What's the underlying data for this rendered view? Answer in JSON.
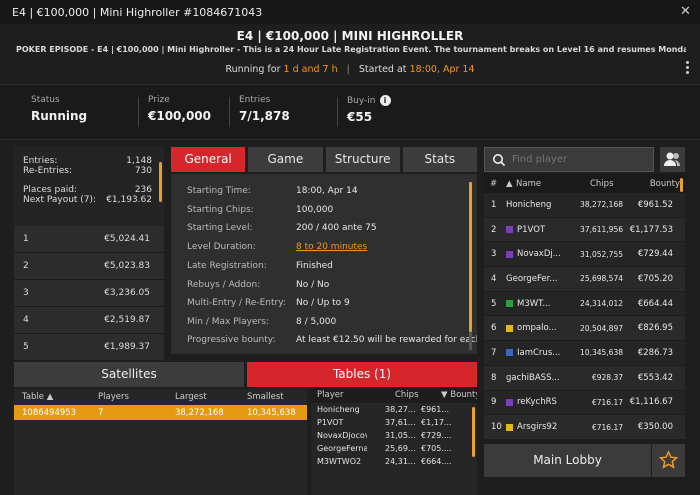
{
  "window": {
    "title": "E4 | €100,000 | Mini Highroller #1084671043"
  },
  "header": {
    "title": "E4 | €100,000 | MINI HIGHROLLER",
    "subtitle": "POKER EPISODE - E4 | €100,000 | Mini Highroller - This is a 24 Hour Late Registration Event. The tournament breaks on Level 16 and resumes Monday at 18:0...",
    "running_prefix": "Running for",
    "running_value": "1 d and 7 h",
    "started_prefix": "Started at",
    "started_value": "18:00, Apr 14"
  },
  "stats": [
    {
      "label": "Status",
      "value": "Running"
    },
    {
      "label": "Prize",
      "value": "€100,000"
    },
    {
      "label": "Entries",
      "value": "7/1,878"
    },
    {
      "label": "Buy-in",
      "value": "€55"
    }
  ],
  "summary": {
    "entries_label": "Entries:",
    "entries_value": "1,148",
    "reentries_label": "Re-Entries:",
    "reentries_value": "730",
    "places_label": "Places paid:",
    "places_value": "236",
    "next_label": "Next Payout (7):",
    "next_value": "€1,193.62"
  },
  "payouts": [
    {
      "place": "1",
      "amount": "€5,024.41"
    },
    {
      "place": "2",
      "amount": "€5,023.83"
    },
    {
      "place": "3",
      "amount": "€3,236.05"
    },
    {
      "place": "4",
      "amount": "€2,519.87"
    },
    {
      "place": "5",
      "amount": "€1,989.37"
    }
  ],
  "tabs": [
    "General",
    "Game",
    "Structure",
    "Stats"
  ],
  "general": [
    {
      "label": "Starting Time:",
      "value": "18:00, Apr 14"
    },
    {
      "label": "Starting Chips:",
      "value": "100,000"
    },
    {
      "label": "Starting Level:",
      "value": "200 / 400 ante 75"
    },
    {
      "label": "Level Duration:",
      "value": "8 to 20 minutes"
    },
    {
      "label": "Late Registration:",
      "value": "Finished"
    },
    {
      "label": "Rebuys / Addon:",
      "value": "No / No"
    },
    {
      "label": "Multi-Entry / Re-Entry:",
      "value": "No / Up to 9"
    },
    {
      "label": "Min / Max Players:",
      "value": "8 / 5,000"
    },
    {
      "label": "Progressive bounty:",
      "value": "At least €12.50 will be rewarded for each"
    }
  ],
  "bottom_tabs": {
    "satellites": "Satellites",
    "tables": "Tables (1)"
  },
  "tables": {
    "headers": [
      "Table",
      "Players",
      "Largest",
      "Smallest"
    ],
    "rows": [
      {
        "table": "1086494953",
        "players": "7",
        "largest": "38,272,168",
        "smallest": "10,345,638"
      }
    ]
  },
  "table_players": {
    "headers": [
      "Player",
      "Chips",
      "Bounty"
    ],
    "rows": [
      {
        "name": "Honicheng",
        "chips": "38,27...",
        "bounty": "€961..."
      },
      {
        "name": "P1VOT",
        "chips": "37,61...",
        "bounty": "€1,17..."
      },
      {
        "name": "NovaxDjocovid",
        "chips": "31,05...",
        "bounty": "€729...."
      },
      {
        "name": "GeorgeFernan...",
        "chips": "25,69...",
        "bounty": "€705...."
      },
      {
        "name": "M3WTWO2",
        "chips": "24,31...",
        "bounty": "€664...."
      }
    ]
  },
  "search": {
    "placeholder": "Find player"
  },
  "players": {
    "headers": {
      "rank": "#",
      "name": "Name",
      "chips": "Chips",
      "bounty": "Bounty"
    },
    "rows": [
      {
        "rank": "1",
        "name": "Honicheng",
        "flag": "",
        "chips": "38,272,168",
        "bounty": "€961.52"
      },
      {
        "rank": "2",
        "name": "P1VOT",
        "flag": "#7b3fb8",
        "chips": "37,611,956",
        "bounty": "€1,177.53"
      },
      {
        "rank": "3",
        "name": "NovaxDj...",
        "flag": "#7b3fb8",
        "chips": "31,052,755",
        "bounty": "€729.44"
      },
      {
        "rank": "4",
        "name": "GeorgeFer...",
        "flag": "",
        "chips": "25,698,574",
        "bounty": "€705.20"
      },
      {
        "rank": "5",
        "name": "M3WT...",
        "flag": "#2e9e3e",
        "chips": "24,314,012",
        "bounty": "€664.44"
      },
      {
        "rank": "6",
        "name": "ompalo...",
        "flag": "#e0b81c",
        "chips": "20,504,897",
        "bounty": "€826.95"
      },
      {
        "rank": "7",
        "name": "IamCrus...",
        "flag": "#3a66c4",
        "chips": "10,345,638",
        "bounty": "€286.73"
      },
      {
        "rank": "8",
        "name": "gachiBASS...",
        "flag": "",
        "chips": "€928.37",
        "bounty": "€553.42"
      },
      {
        "rank": "9",
        "name": "reKychRS",
        "flag": "#7b3fb8",
        "chips": "€716.17",
        "bounty": "€1,116.67"
      },
      {
        "rank": "10",
        "name": "Arsgirs92",
        "flag": "#e0b81c",
        "chips": "€716.17",
        "bounty": "€350.00"
      }
    ]
  },
  "buttons": {
    "main_lobby": "Main Lobby"
  },
  "colors": {
    "accent_red": "#d6262b",
    "accent_orange": "#f29a1f",
    "row_highlight": "#e49a12"
  }
}
